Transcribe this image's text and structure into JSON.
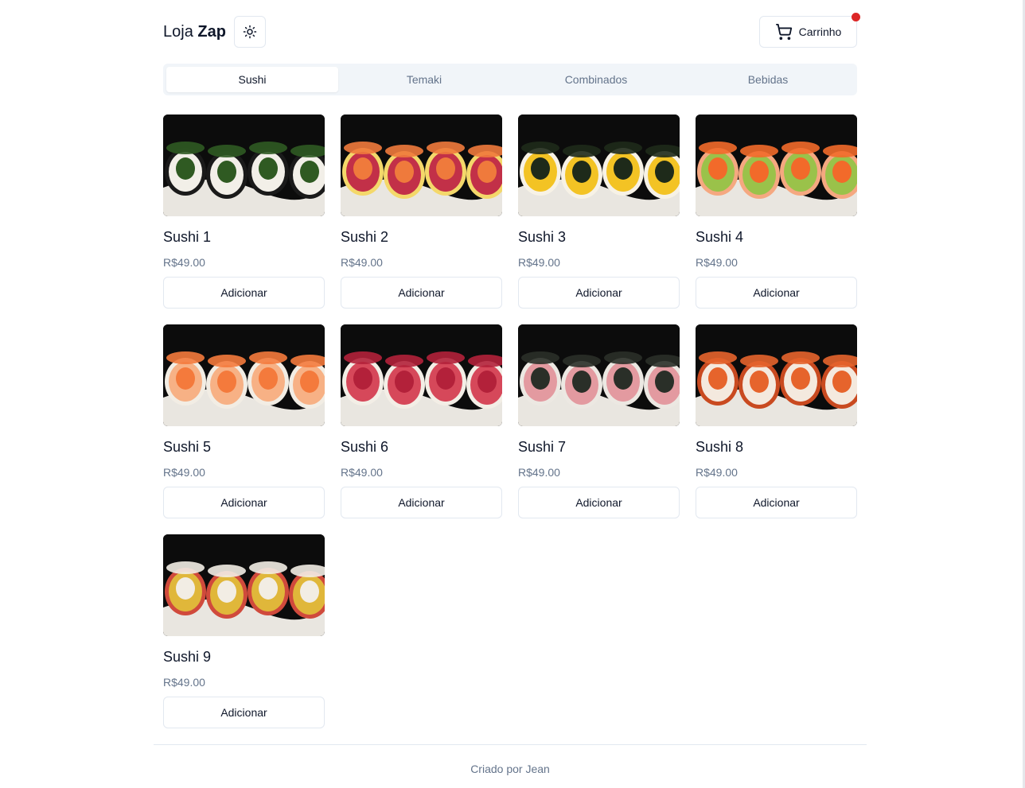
{
  "header": {
    "brand_light": "Loja",
    "brand_bold": "Zap",
    "theme_icon": "sun-icon",
    "cart_label": "Carrinho",
    "cart_icon": "shopping-cart-icon",
    "cart_badge_color": "#dc2626"
  },
  "tabs": [
    {
      "label": "Sushi",
      "active": true
    },
    {
      "label": "Temaki",
      "active": false
    },
    {
      "label": "Combinados",
      "active": false
    },
    {
      "label": "Bebidas",
      "active": false
    }
  ],
  "products": [
    {
      "name": "Sushi 1",
      "price": "R$49.00",
      "button": "Adicionar",
      "palette": [
        "#2f5a22",
        "#f2efe8",
        "#1a1a1a"
      ]
    },
    {
      "name": "Sushi 2",
      "price": "R$49.00",
      "button": "Adicionar",
      "palette": [
        "#ef7a3c",
        "#c23048",
        "#f4d86a"
      ]
    },
    {
      "name": "Sushi 3",
      "price": "R$49.00",
      "button": "Adicionar",
      "palette": [
        "#1e2a1a",
        "#f3c324",
        "#f7f2e6"
      ]
    },
    {
      "name": "Sushi 4",
      "price": "R$49.00",
      "button": "Adicionar",
      "palette": [
        "#f26a2a",
        "#9ac24a",
        "#f5a880"
      ]
    },
    {
      "name": "Sushi 5",
      "price": "R$49.00",
      "button": "Adicionar",
      "palette": [
        "#f47a3c",
        "#f7b185",
        "#f2ede4"
      ]
    },
    {
      "name": "Sushi 6",
      "price": "R$49.00",
      "button": "Adicionar",
      "palette": [
        "#b3213a",
        "#d6485a",
        "#f3eee6"
      ]
    },
    {
      "name": "Sushi 7",
      "price": "R$49.00",
      "button": "Adicionar",
      "palette": [
        "#2a2f28",
        "#e39aa0",
        "#ece8e2"
      ]
    },
    {
      "name": "Sushi 8",
      "price": "R$49.00",
      "button": "Adicionar",
      "palette": [
        "#e6642c",
        "#f4e9de",
        "#c94a20"
      ]
    },
    {
      "name": "Sushi 9",
      "price": "R$49.00",
      "button": "Adicionar",
      "palette": [
        "#f2ede4",
        "#e0b73a",
        "#d04a3c"
      ]
    }
  ],
  "footer": {
    "text": "Criado por Jean"
  }
}
